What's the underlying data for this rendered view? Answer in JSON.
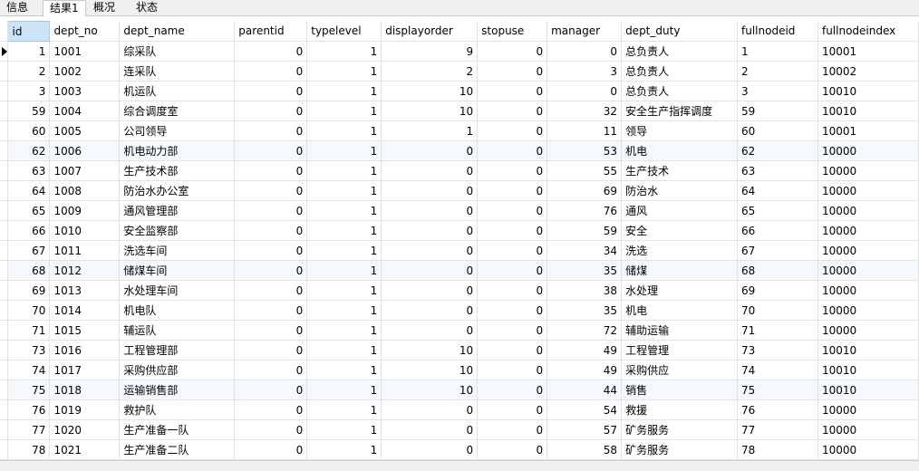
{
  "tabs": [
    {
      "label": "信息",
      "active": false
    },
    {
      "label": "结果1",
      "active": true
    },
    {
      "label": "概况",
      "active": false
    },
    {
      "label": "状态",
      "active": false
    }
  ],
  "columns": [
    "id",
    "dept_no",
    "dept_name",
    "parentid",
    "typelevel",
    "displayorder",
    "stopuse",
    "manager",
    "dept_duty",
    "fullnodeid",
    "fullnodeindex"
  ],
  "rows": [
    [
      "1",
      "1001",
      "综采队",
      "0",
      "1",
      "9",
      "0",
      "0",
      "总负责人",
      "1",
      "10001"
    ],
    [
      "2",
      "1002",
      "连采队",
      "0",
      "1",
      "2",
      "0",
      "3",
      "总负责人",
      "2",
      "10002"
    ],
    [
      "3",
      "1003",
      "机运队",
      "0",
      "1",
      "10",
      "0",
      "0",
      "总负责人",
      "3",
      "10010"
    ],
    [
      "59",
      "1004",
      "综合调度室",
      "0",
      "1",
      "10",
      "0",
      "32",
      "安全生产指挥调度",
      "59",
      "10010"
    ],
    [
      "60",
      "1005",
      "公司领导",
      "0",
      "1",
      "1",
      "0",
      "11",
      "领导",
      "60",
      "10001"
    ],
    [
      "62",
      "1006",
      "机电动力部",
      "0",
      "1",
      "0",
      "0",
      "53",
      "机电",
      "62",
      "10000"
    ],
    [
      "63",
      "1007",
      "生产技术部",
      "0",
      "1",
      "0",
      "0",
      "55",
      "生产技术",
      "63",
      "10000"
    ],
    [
      "64",
      "1008",
      "防治水办公室",
      "0",
      "1",
      "0",
      "0",
      "69",
      "防治水",
      "64",
      "10000"
    ],
    [
      "65",
      "1009",
      "通风管理部",
      "0",
      "1",
      "0",
      "0",
      "76",
      "通风",
      "65",
      "10000"
    ],
    [
      "66",
      "1010",
      "安全监察部",
      "0",
      "1",
      "0",
      "0",
      "59",
      "安全",
      "66",
      "10000"
    ],
    [
      "67",
      "1011",
      "洗选车间",
      "0",
      "1",
      "0",
      "0",
      "34",
      "洗选",
      "67",
      "10000"
    ],
    [
      "68",
      "1012",
      "储煤车间",
      "0",
      "1",
      "0",
      "0",
      "35",
      "储煤",
      "68",
      "10000"
    ],
    [
      "69",
      "1013",
      "水处理车间",
      "0",
      "1",
      "0",
      "0",
      "38",
      "水处理",
      "69",
      "10000"
    ],
    [
      "70",
      "1014",
      "机电队",
      "0",
      "1",
      "0",
      "0",
      "35",
      "机电",
      "70",
      "10000"
    ],
    [
      "71",
      "1015",
      "辅运队",
      "0",
      "1",
      "0",
      "0",
      "72",
      "辅助运输",
      "71",
      "10000"
    ],
    [
      "73",
      "1016",
      "工程管理部",
      "0",
      "1",
      "10",
      "0",
      "49",
      "工程管理",
      "73",
      "10010"
    ],
    [
      "74",
      "1017",
      "采购供应部",
      "0",
      "1",
      "10",
      "0",
      "49",
      "采购供应",
      "74",
      "10010"
    ],
    [
      "75",
      "1018",
      "运输销售部",
      "0",
      "1",
      "10",
      "0",
      "44",
      "销售",
      "75",
      "10010"
    ],
    [
      "76",
      "1019",
      "救护队",
      "0",
      "1",
      "0",
      "0",
      "54",
      "救援",
      "76",
      "10000"
    ],
    [
      "77",
      "1020",
      "生产准备一队",
      "0",
      "1",
      "0",
      "0",
      "57",
      "矿务服务",
      "77",
      "10000"
    ],
    [
      "78",
      "1021",
      "生产准备二队",
      "0",
      "1",
      "0",
      "0",
      "58",
      "矿务服务",
      "78",
      "10000"
    ]
  ]
}
